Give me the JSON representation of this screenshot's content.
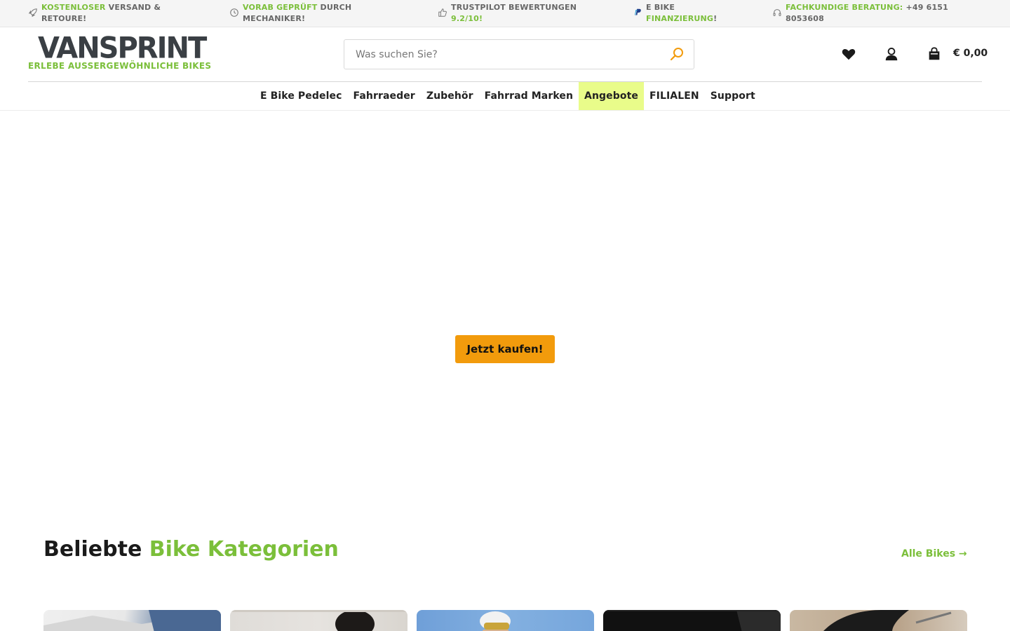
{
  "topbar": {
    "items": [
      {
        "green": "KOSTENLOSER",
        "dark": "VERSAND & RETOURE!",
        "icon": "rocket-icon"
      },
      {
        "green": "VORAB GEPRÜFT",
        "dark": "DURCH MECHANIKER!",
        "icon": "clock-icon"
      },
      {
        "dark": "TRUSTPILOT BEWERTUNGEN",
        "green": "9.2/10",
        "tail": "!",
        "icon": "thumbs-up-icon"
      },
      {
        "dark": "E BIKE",
        "green": "FINANZIERUNG",
        "tail": "!",
        "icon": "paypal-icon"
      },
      {
        "green": "FACHKUNDIGE BERATUNG:",
        "dark": "+49 6151 8053608",
        "icon": "headset-icon"
      }
    ]
  },
  "header": {
    "logo_word": "VANSPRINT",
    "logo_tagline": "ERLEBE AUSSERGEWÖHNLICHE BIKES",
    "search_placeholder": "Was suchen Sie?",
    "cart_total": "€ 0,00"
  },
  "nav": {
    "items": [
      "E Bike Pedelec",
      "Fahrraeder",
      "Zubehör",
      "Fahrrad Marken",
      "Angebote",
      "FILIALEN",
      "Support"
    ],
    "highlighted": "Angebote"
  },
  "hero": {
    "cta_label": "Jetzt kaufen!"
  },
  "categories": {
    "title_dark": "Beliebte",
    "title_green": "Bike Kategorien",
    "all_link": "Alle Bikes →"
  },
  "colors": {
    "brand_green": "#7bbf3a",
    "cta_orange": "#f29b0c",
    "nav_highlight": "#e9fc8a",
    "logo_gray": "#3a3f44"
  }
}
